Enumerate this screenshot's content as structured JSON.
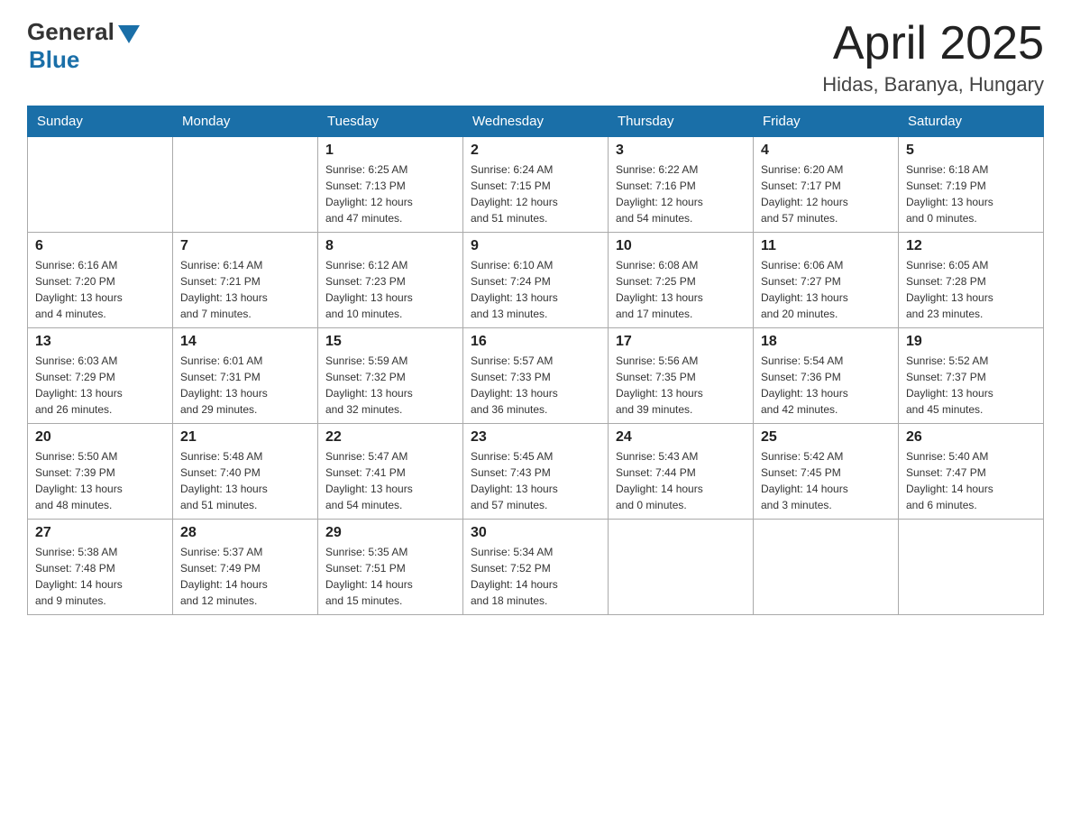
{
  "header": {
    "logo_general": "General",
    "logo_blue": "Blue",
    "month_title": "April 2025",
    "location": "Hidas, Baranya, Hungary"
  },
  "days_of_week": [
    "Sunday",
    "Monday",
    "Tuesday",
    "Wednesday",
    "Thursday",
    "Friday",
    "Saturday"
  ],
  "weeks": [
    [
      {
        "day": "",
        "info": ""
      },
      {
        "day": "",
        "info": ""
      },
      {
        "day": "1",
        "info": "Sunrise: 6:25 AM\nSunset: 7:13 PM\nDaylight: 12 hours\nand 47 minutes."
      },
      {
        "day": "2",
        "info": "Sunrise: 6:24 AM\nSunset: 7:15 PM\nDaylight: 12 hours\nand 51 minutes."
      },
      {
        "day": "3",
        "info": "Sunrise: 6:22 AM\nSunset: 7:16 PM\nDaylight: 12 hours\nand 54 minutes."
      },
      {
        "day": "4",
        "info": "Sunrise: 6:20 AM\nSunset: 7:17 PM\nDaylight: 12 hours\nand 57 minutes."
      },
      {
        "day": "5",
        "info": "Sunrise: 6:18 AM\nSunset: 7:19 PM\nDaylight: 13 hours\nand 0 minutes."
      }
    ],
    [
      {
        "day": "6",
        "info": "Sunrise: 6:16 AM\nSunset: 7:20 PM\nDaylight: 13 hours\nand 4 minutes."
      },
      {
        "day": "7",
        "info": "Sunrise: 6:14 AM\nSunset: 7:21 PM\nDaylight: 13 hours\nand 7 minutes."
      },
      {
        "day": "8",
        "info": "Sunrise: 6:12 AM\nSunset: 7:23 PM\nDaylight: 13 hours\nand 10 minutes."
      },
      {
        "day": "9",
        "info": "Sunrise: 6:10 AM\nSunset: 7:24 PM\nDaylight: 13 hours\nand 13 minutes."
      },
      {
        "day": "10",
        "info": "Sunrise: 6:08 AM\nSunset: 7:25 PM\nDaylight: 13 hours\nand 17 minutes."
      },
      {
        "day": "11",
        "info": "Sunrise: 6:06 AM\nSunset: 7:27 PM\nDaylight: 13 hours\nand 20 minutes."
      },
      {
        "day": "12",
        "info": "Sunrise: 6:05 AM\nSunset: 7:28 PM\nDaylight: 13 hours\nand 23 minutes."
      }
    ],
    [
      {
        "day": "13",
        "info": "Sunrise: 6:03 AM\nSunset: 7:29 PM\nDaylight: 13 hours\nand 26 minutes."
      },
      {
        "day": "14",
        "info": "Sunrise: 6:01 AM\nSunset: 7:31 PM\nDaylight: 13 hours\nand 29 minutes."
      },
      {
        "day": "15",
        "info": "Sunrise: 5:59 AM\nSunset: 7:32 PM\nDaylight: 13 hours\nand 32 minutes."
      },
      {
        "day": "16",
        "info": "Sunrise: 5:57 AM\nSunset: 7:33 PM\nDaylight: 13 hours\nand 36 minutes."
      },
      {
        "day": "17",
        "info": "Sunrise: 5:56 AM\nSunset: 7:35 PM\nDaylight: 13 hours\nand 39 minutes."
      },
      {
        "day": "18",
        "info": "Sunrise: 5:54 AM\nSunset: 7:36 PM\nDaylight: 13 hours\nand 42 minutes."
      },
      {
        "day": "19",
        "info": "Sunrise: 5:52 AM\nSunset: 7:37 PM\nDaylight: 13 hours\nand 45 minutes."
      }
    ],
    [
      {
        "day": "20",
        "info": "Sunrise: 5:50 AM\nSunset: 7:39 PM\nDaylight: 13 hours\nand 48 minutes."
      },
      {
        "day": "21",
        "info": "Sunrise: 5:48 AM\nSunset: 7:40 PM\nDaylight: 13 hours\nand 51 minutes."
      },
      {
        "day": "22",
        "info": "Sunrise: 5:47 AM\nSunset: 7:41 PM\nDaylight: 13 hours\nand 54 minutes."
      },
      {
        "day": "23",
        "info": "Sunrise: 5:45 AM\nSunset: 7:43 PM\nDaylight: 13 hours\nand 57 minutes."
      },
      {
        "day": "24",
        "info": "Sunrise: 5:43 AM\nSunset: 7:44 PM\nDaylight: 14 hours\nand 0 minutes."
      },
      {
        "day": "25",
        "info": "Sunrise: 5:42 AM\nSunset: 7:45 PM\nDaylight: 14 hours\nand 3 minutes."
      },
      {
        "day": "26",
        "info": "Sunrise: 5:40 AM\nSunset: 7:47 PM\nDaylight: 14 hours\nand 6 minutes."
      }
    ],
    [
      {
        "day": "27",
        "info": "Sunrise: 5:38 AM\nSunset: 7:48 PM\nDaylight: 14 hours\nand 9 minutes."
      },
      {
        "day": "28",
        "info": "Sunrise: 5:37 AM\nSunset: 7:49 PM\nDaylight: 14 hours\nand 12 minutes."
      },
      {
        "day": "29",
        "info": "Sunrise: 5:35 AM\nSunset: 7:51 PM\nDaylight: 14 hours\nand 15 minutes."
      },
      {
        "day": "30",
        "info": "Sunrise: 5:34 AM\nSunset: 7:52 PM\nDaylight: 14 hours\nand 18 minutes."
      },
      {
        "day": "",
        "info": ""
      },
      {
        "day": "",
        "info": ""
      },
      {
        "day": "",
        "info": ""
      }
    ]
  ]
}
